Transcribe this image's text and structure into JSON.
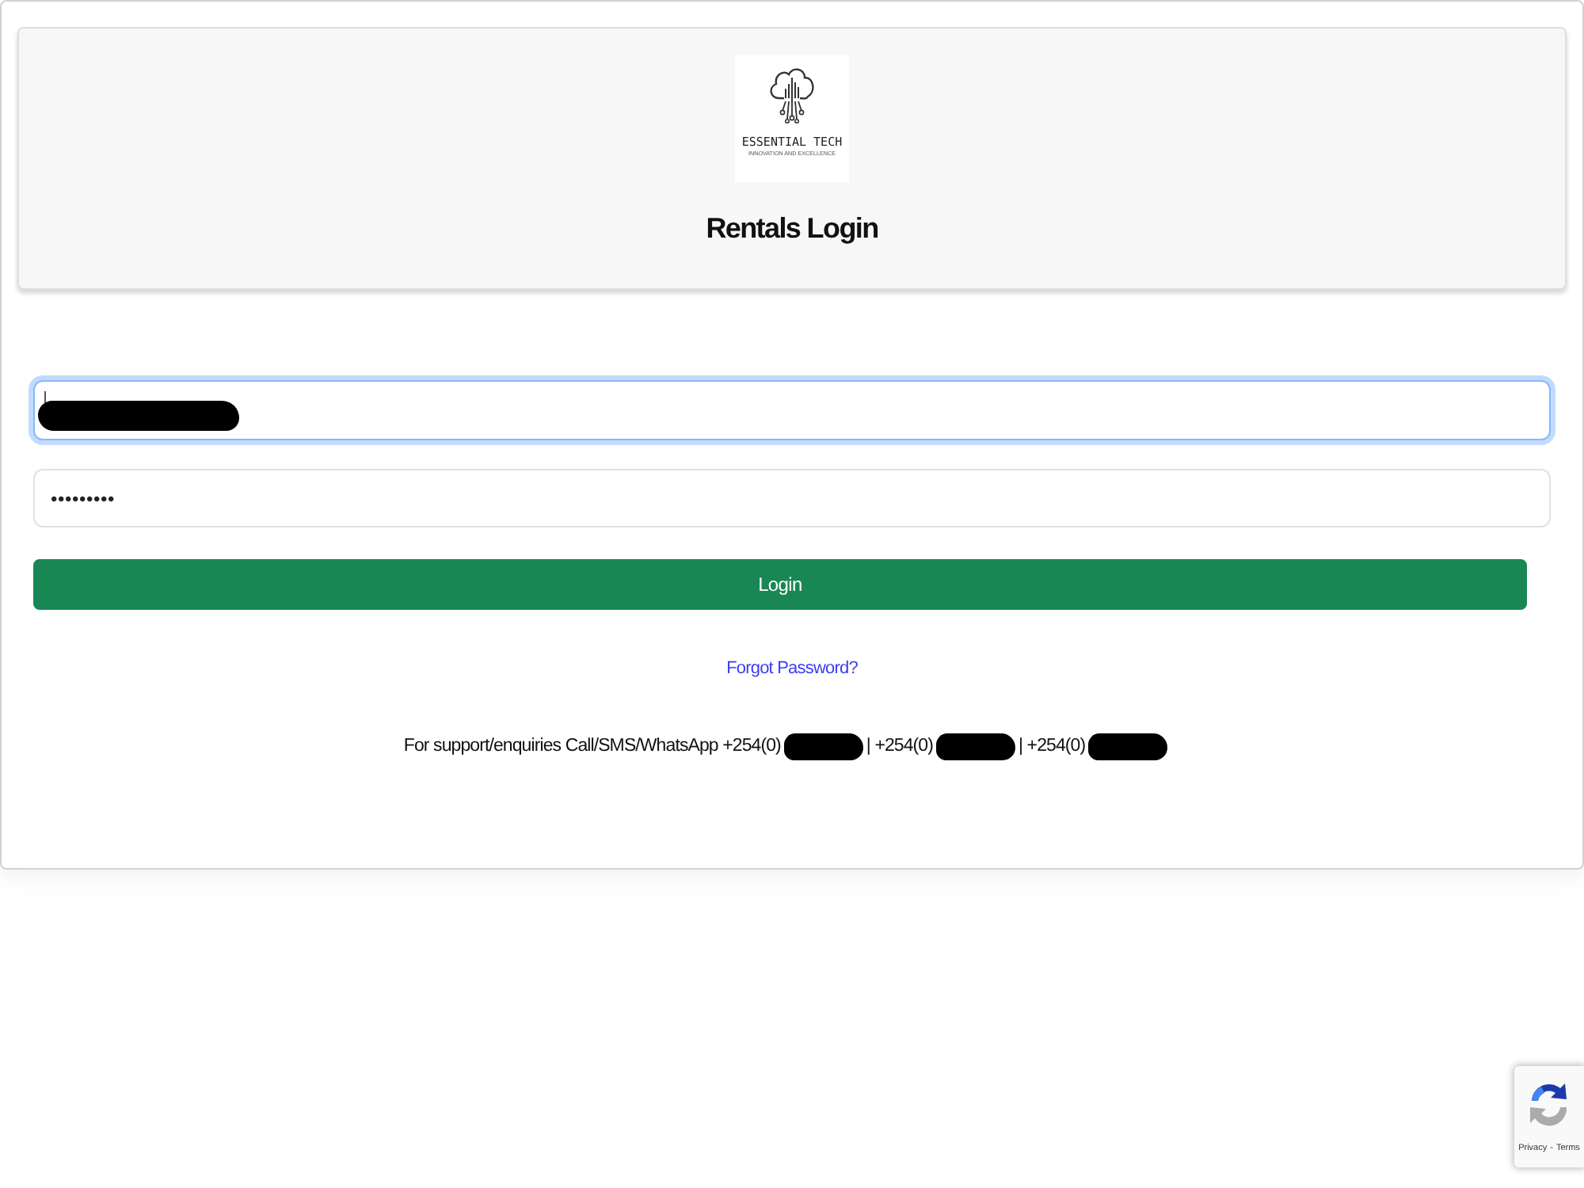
{
  "header": {
    "logo": {
      "name": "ESSENTIAL TECH",
      "tagline": "INNOVATION AND EXCELLENCE"
    },
    "title": "Rentals Login"
  },
  "form": {
    "text_field": {
      "focused": true,
      "redacted": true
    },
    "password_field": {
      "value": "•••••••••",
      "focused": false
    },
    "submit": "Login",
    "forgot_link": "Forgot Password?"
  },
  "support": [
    {
      "kind": "text",
      "text": "For support/enquiries Call/SMS/WhatsApp +254(0)"
    },
    {
      "kind": "redaction"
    },
    {
      "kind": "text",
      "text": "| +254(0)"
    },
    {
      "kind": "redaction"
    },
    {
      "kind": "text",
      "text": "| +254(0)"
    },
    {
      "kind": "redaction"
    }
  ],
  "recaptcha": {
    "privacy": "Privacy",
    "separator": "-",
    "terms": "Terms"
  }
}
